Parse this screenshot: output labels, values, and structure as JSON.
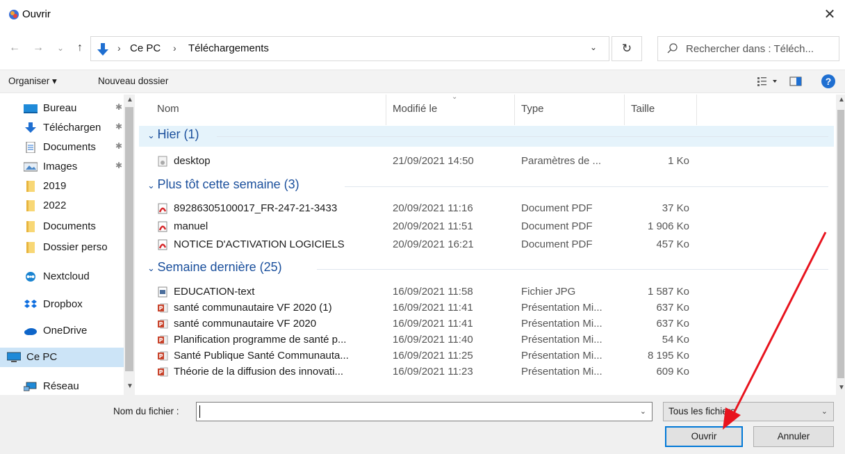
{
  "window": {
    "title": "Ouvrir",
    "close_glyph": "✕"
  },
  "nav": {
    "back_glyph": "←",
    "forward_glyph": "→",
    "recent_glyph": "⌄",
    "up_glyph": "↑",
    "breadcrumb": [
      "Ce PC",
      "Téléchargements"
    ],
    "refresh_glyph": "↻",
    "search_placeholder": "Rechercher dans : Téléch..."
  },
  "toolbar": {
    "organize_label": "Organiser ▾",
    "new_folder_label": "Nouveau dossier",
    "help_label": "?"
  },
  "sidebar": {
    "items": [
      {
        "label": "Bureau",
        "icon": "desktop-icon",
        "pinned": true
      },
      {
        "label": "Téléchargen",
        "icon": "download-icon",
        "pinned": true
      },
      {
        "label": "Documents",
        "icon": "document-icon",
        "pinned": true
      },
      {
        "label": "Images",
        "icon": "images-icon",
        "pinned": true
      },
      {
        "label": "2019",
        "icon": "folder-icon",
        "pinned": false
      },
      {
        "label": "2022",
        "icon": "folder-icon",
        "pinned": false
      },
      {
        "label": "Documents",
        "icon": "folder-icon",
        "pinned": false
      },
      {
        "label": "Dossier perso",
        "icon": "folder-icon",
        "pinned": false
      },
      {
        "label": "Nextcloud",
        "icon": "nextcloud-icon",
        "pinned": false
      },
      {
        "label": "Dropbox",
        "icon": "dropbox-icon",
        "pinned": false
      },
      {
        "label": "OneDrive",
        "icon": "onedrive-icon",
        "pinned": false
      },
      {
        "label": "Ce PC",
        "icon": "computer-icon",
        "pinned": false,
        "selected": true
      },
      {
        "label": "Réseau",
        "icon": "network-icon",
        "pinned": false
      }
    ]
  },
  "filelist": {
    "columns": {
      "name": "Nom",
      "modified": "Modifié le",
      "type": "Type",
      "size": "Taille"
    },
    "groups": [
      {
        "label": "Hier (1)",
        "files": [
          {
            "name": "desktop",
            "modified": "21/09/2021 14:50",
            "type": "Paramètres de ...",
            "size": "1 Ko",
            "icon": "settings-file-icon"
          }
        ]
      },
      {
        "label": "Plus tôt cette semaine (3)",
        "files": [
          {
            "name": "89286305100017_FR-247-21-3433",
            "modified": "20/09/2021 11:16",
            "type": "Document PDF",
            "size": "37 Ko",
            "icon": "pdf-icon"
          },
          {
            "name": "manuel",
            "modified": "20/09/2021 11:51",
            "type": "Document PDF",
            "size": "1 906 Ko",
            "icon": "pdf-icon"
          },
          {
            "name": "NOTICE D'ACTIVATION LOGICIELS",
            "modified": "20/09/2021 16:21",
            "type": "Document PDF",
            "size": "457 Ko",
            "icon": "pdf-icon"
          }
        ]
      },
      {
        "label": "Semaine dernière (25)",
        "files": [
          {
            "name": "EDUCATION-text",
            "modified": "16/09/2021 11:58",
            "type": "Fichier JPG",
            "size": "1 587 Ko",
            "icon": "image-file-icon"
          },
          {
            "name": "santé communautaire VF 2020 (1)",
            "modified": "16/09/2021 11:41",
            "type": "Présentation Mi...",
            "size": "637 Ko",
            "icon": "powerpoint-icon"
          },
          {
            "name": "santé communautaire VF 2020",
            "modified": "16/09/2021 11:41",
            "type": "Présentation Mi...",
            "size": "637 Ko",
            "icon": "powerpoint-icon"
          },
          {
            "name": "Planification programme de santé p...",
            "modified": "16/09/2021 11:40",
            "type": "Présentation Mi...",
            "size": "54 Ko",
            "icon": "powerpoint-icon"
          },
          {
            "name": "Santé Publique Santé Communauta...",
            "modified": "16/09/2021 11:25",
            "type": "Présentation Mi...",
            "size": "8 195 Ko",
            "icon": "powerpoint-icon"
          },
          {
            "name": "Théorie de la diffusion des innovati...",
            "modified": "16/09/2021 11:23",
            "type": "Présentation Mi...",
            "size": "609 Ko",
            "icon": "powerpoint-icon"
          }
        ]
      }
    ]
  },
  "footer": {
    "filename_label": "Nom du fichier :",
    "filename_value": "",
    "filter_value": "Tous les fichiers",
    "open_label": "Ouvrir",
    "cancel_label": "Annuler"
  },
  "colors": {
    "accent": "#0078d7",
    "group_text": "#1a4f9c",
    "selection": "#cce4f7",
    "annotation_arrow": "#e8141e"
  }
}
